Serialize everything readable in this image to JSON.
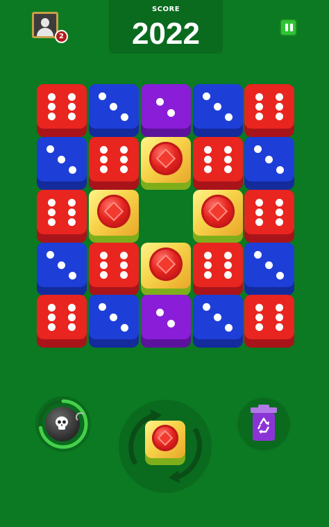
{
  "header": {
    "score_label": "SCORE",
    "score_value": "2022",
    "player_level": "2",
    "avatar_icon": "user-avatar-icon",
    "pause_icon": "pause-icon"
  },
  "colors": {
    "background": "#0b7a22",
    "red_die": "#e8251f",
    "blue_die": "#1d3fd8",
    "purple_die": "#8a1ed8",
    "gem_tile": "#f7d34a",
    "gem": "#e4231e"
  },
  "board": {
    "rows": 5,
    "cols": 5,
    "cells": [
      [
        {
          "type": "die",
          "color": "red",
          "value": 6
        },
        {
          "type": "die",
          "color": "blue",
          "value": 3
        },
        {
          "type": "die",
          "color": "purple",
          "value": 2
        },
        {
          "type": "die",
          "color": "blue",
          "value": 3
        },
        {
          "type": "die",
          "color": "red",
          "value": 6
        }
      ],
      [
        {
          "type": "die",
          "color": "blue",
          "value": 3
        },
        {
          "type": "die",
          "color": "red",
          "value": 6
        },
        {
          "type": "gem"
        },
        {
          "type": "die",
          "color": "red",
          "value": 6
        },
        {
          "type": "die",
          "color": "blue",
          "value": 3
        }
      ],
      [
        {
          "type": "die",
          "color": "red",
          "value": 6
        },
        {
          "type": "gem"
        },
        {
          "type": "empty"
        },
        {
          "type": "gem"
        },
        {
          "type": "die",
          "color": "red",
          "value": 6
        }
      ],
      [
        {
          "type": "die",
          "color": "blue",
          "value": 3
        },
        {
          "type": "die",
          "color": "red",
          "value": 6
        },
        {
          "type": "gem"
        },
        {
          "type": "die",
          "color": "red",
          "value": 6
        },
        {
          "type": "die",
          "color": "blue",
          "value": 3
        }
      ],
      [
        {
          "type": "die",
          "color": "red",
          "value": 6
        },
        {
          "type": "die",
          "color": "blue",
          "value": 3
        },
        {
          "type": "die",
          "color": "purple",
          "value": 2
        },
        {
          "type": "die",
          "color": "blue",
          "value": 3
        },
        {
          "type": "die",
          "color": "red",
          "value": 6
        }
      ]
    ]
  },
  "controls": {
    "bomb_icon": "bomb-icon",
    "swap_icon": "swap-arrows-icon",
    "next_piece": "gem",
    "trash_icon": "recycle-bin-icon"
  }
}
